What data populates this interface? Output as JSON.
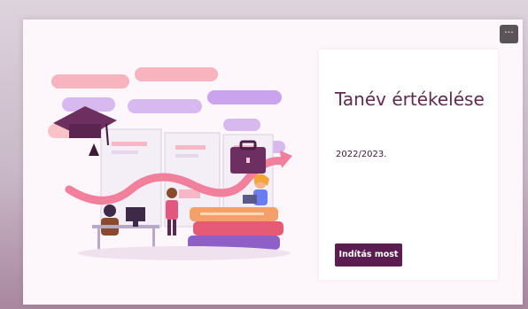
{
  "toolbar": {
    "more_label": "···"
  },
  "panel": {
    "title": "Tanév értékelése",
    "subtitle": "2022/2023.",
    "start_label": "Indítás most"
  },
  "colors": {
    "accent": "#5b1d4f",
    "title": "#5e2a52",
    "card_background": "#fdf6fb"
  },
  "illustration": {
    "icons": [
      "graduation-cap-icon",
      "briefcase-icon",
      "book-stack-icon",
      "growth-arrow-icon"
    ]
  }
}
